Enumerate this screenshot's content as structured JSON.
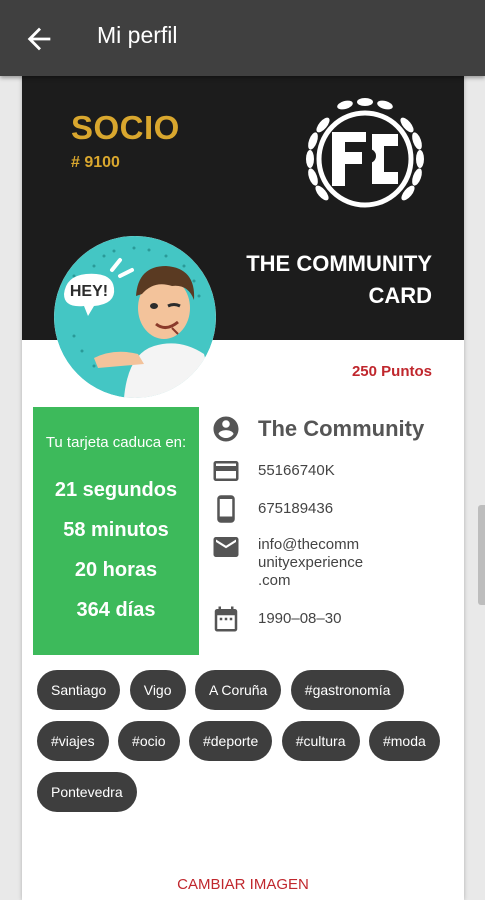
{
  "appbar": {
    "title": "Mi perfil"
  },
  "card": {
    "role": "SOCIO",
    "member_number": "# 9100",
    "brand_line1": "THE COMMUNITY",
    "brand_line2": "CARD",
    "points": "250 Puntos"
  },
  "expiry": {
    "label": "Tu tarjeta caduca en:",
    "seconds": "21 segundos",
    "minutes": "58 minutos",
    "hours": "20 horas",
    "days": "364 días"
  },
  "profile": {
    "name": "The Community",
    "id_number": "55166740K",
    "phone": "675189436",
    "email_line1": "info@thecomm",
    "email_line2": "unityexperience",
    "email_line3": ".com",
    "birthdate": "1990–08–30"
  },
  "avatar_text": "HEY!",
  "tags": [
    "Santiago",
    "Vigo",
    "A Coruña",
    "#gastronomía",
    "#viajes",
    "#ocio",
    "#deporte",
    "#cultura",
    "#moda",
    "Pontevedra"
  ],
  "actions": {
    "change_image": "CAMBIAR IMAGEN"
  },
  "colors": {
    "appbar": "#404040",
    "card_dark": "#1c1c1c",
    "gold": "#d9a72e",
    "green": "#3dba5b",
    "red": "#c0272d",
    "tag_bg": "#3e3e3e"
  }
}
